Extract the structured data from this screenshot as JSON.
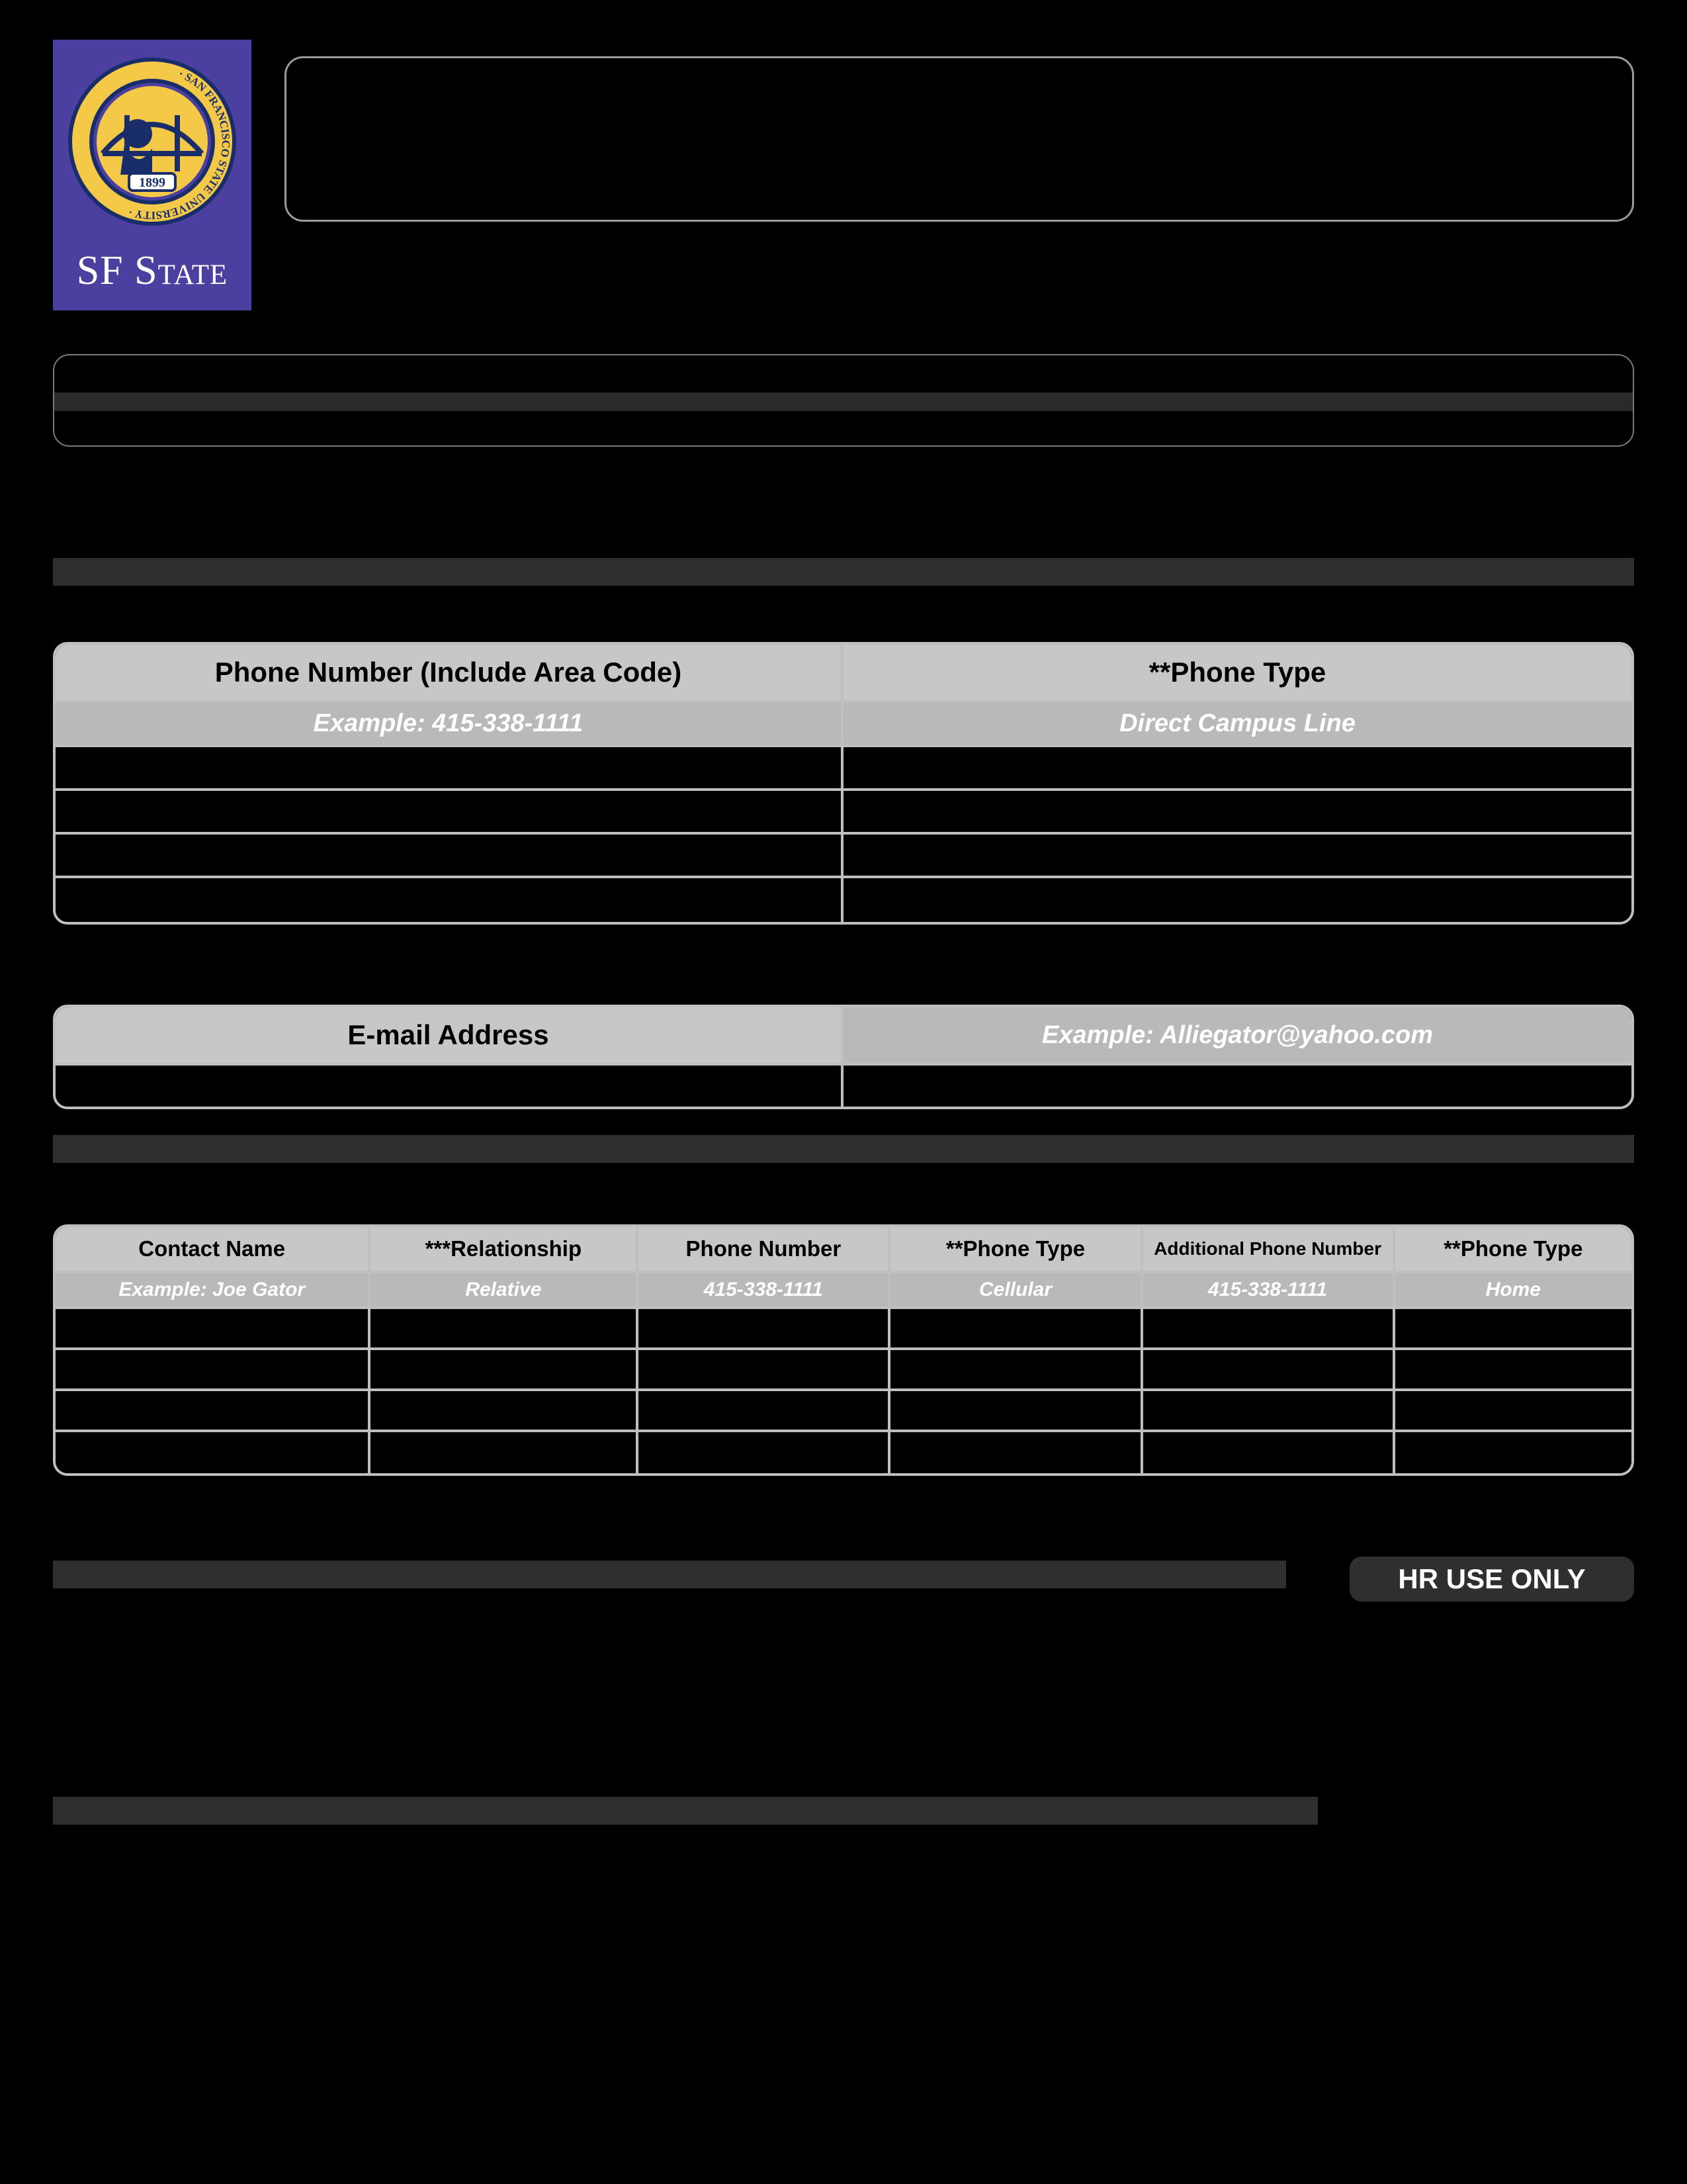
{
  "logo": {
    "text": "SF State",
    "seal_text_top": "SAN FRANCISCO STATE UNIVERSITY",
    "seal_year": "1899"
  },
  "phone_table": {
    "headers": {
      "number": "Phone Number (Include Area Code)",
      "type": "**Phone Type"
    },
    "example": {
      "number": "Example: 415-338-1111",
      "type": "Direct Campus Line"
    }
  },
  "email_table": {
    "header": "E-mail Address",
    "example": "Example: Alliegator@yahoo.com"
  },
  "contacts_table": {
    "headers": {
      "name": "Contact Name",
      "relationship": "***Relationship",
      "phone": "Phone Number",
      "type": "**Phone Type",
      "add_phone": "Additional Phone Number",
      "add_type": "**Phone Type"
    },
    "example": {
      "name": "Example: Joe Gator",
      "relationship": "Relative",
      "phone": "415-338-1111",
      "type": "Cellular",
      "add_phone": "415-338-1111",
      "add_type": "Home"
    }
  },
  "hr_badge": "HR USE ONLY"
}
